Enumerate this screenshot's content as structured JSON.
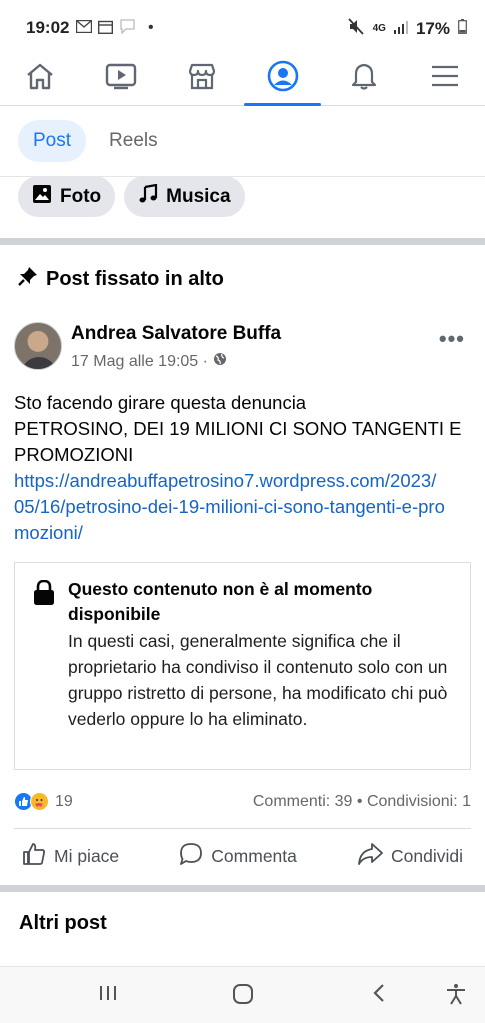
{
  "status_bar": {
    "time": "19:02",
    "network": "4G",
    "battery": "17%",
    "dot": "•",
    "icons": [
      "gmail-icon",
      "calendar-icon",
      "chat-bubble-icon",
      "mute-icon",
      "signal-icon",
      "battery-icon"
    ]
  },
  "top_nav": {
    "items": [
      {
        "name": "home-icon",
        "active": false
      },
      {
        "name": "video-icon",
        "active": false
      },
      {
        "name": "marketplace-icon",
        "active": false
      },
      {
        "name": "profile-icon",
        "active": true
      },
      {
        "name": "bell-icon",
        "active": false
      },
      {
        "name": "menu-icon",
        "active": false
      }
    ],
    "accent": "#1877f2"
  },
  "tabs": [
    {
      "label": "Post",
      "active": true
    },
    {
      "label": "Reels",
      "active": false
    }
  ],
  "chips": [
    {
      "label": "Foto",
      "icon": "photo-icon"
    },
    {
      "label": "Musica",
      "icon": "music-icon"
    }
  ],
  "pinned": {
    "label": "Post fissato in alto",
    "icon": "pin-icon"
  },
  "post": {
    "author": "Andrea Salvatore Buffa",
    "date": "17 Mag alle 19:05 ·",
    "privacy_icon": "globe-icon",
    "more": "•••",
    "text_line1": "Sto facendo girare questa denuncia",
    "text_line2": "PETROSINO, DEI 19 MILIONI CI SONO TANGENTI E PROMOZIONI",
    "link": "https://andreabuffapetrosino7.wordpress.com/2023/05/16/petrosino-dei-19-milioni-ci-sono-tangenti-e-promozioni/",
    "unavailable_title": "Questo contenuto non è al momento disponibile",
    "unavailable_body": "In questi casi, generalmente significa che il proprietario ha condiviso il contenuto solo con un gruppo ristretto di persone, ha modificato chi può vederlo oppure lo ha eliminato.",
    "reactions_count": "19",
    "stats": "Commenti: 39 • Condivisioni: 1",
    "actions": {
      "like": "Mi piace",
      "comment": "Commenta",
      "share": "Condividi"
    }
  },
  "more_posts_heading": "Altri post",
  "system_nav": [
    "recents-icon",
    "home-circle-icon",
    "back-icon",
    "accessibility-icon"
  ]
}
